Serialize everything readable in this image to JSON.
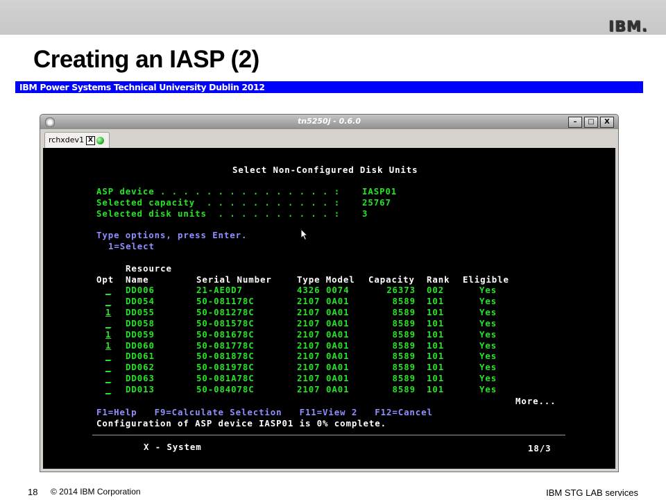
{
  "slide": {
    "logo": "IBM.",
    "title": "Creating an IASP (2)",
    "subtitle": "IBM Power Systems Technical  University Dublin 2012",
    "page_number": "18",
    "copyright": "© 2014 IBM Corporation",
    "footer_right": "IBM STG LAB services"
  },
  "window": {
    "title": "tn5250j - 0.6.0",
    "buttons": {
      "minimize": "–",
      "maximize": "□",
      "close": "X"
    },
    "tab": {
      "label": "rchxdev1",
      "close": "X"
    }
  },
  "screen": {
    "heading": "Select Non-Configured Disk Units",
    "fields": [
      {
        "label": "ASP device . . . . . . . . . . . . . . . :",
        "value": "IASP01"
      },
      {
        "label": "Selected capacity  . . . . . . . . . . . :",
        "value": "25767"
      },
      {
        "label": "Selected disk units  . . . . . . . . . . :",
        "value": "3"
      }
    ],
    "instructions": "Type options, press Enter.",
    "option_legend": "1=Select",
    "headers": {
      "resource": "Resource",
      "opt": "Opt",
      "name": "Name",
      "serial": "Serial Number",
      "type_model": "Type Model",
      "capacity": "Capacity",
      "rank": "Rank",
      "eligible": "Eligible"
    },
    "rows": [
      {
        "opt": "_",
        "name": "DD006",
        "serial": "21-AE0D7",
        "type": "4326",
        "model": "0074",
        "capacity": "26373",
        "rank": "002",
        "eligible": "Yes"
      },
      {
        "opt": "_",
        "name": "DD054",
        "serial": "50-081178C",
        "type": "2107",
        "model": "0A01",
        "capacity": "8589",
        "rank": "101",
        "eligible": "Yes"
      },
      {
        "opt": "1",
        "name": "DD055",
        "serial": "50-081278C",
        "type": "2107",
        "model": "0A01",
        "capacity": "8589",
        "rank": "101",
        "eligible": "Yes"
      },
      {
        "opt": "_",
        "name": "DD058",
        "serial": "50-081578C",
        "type": "2107",
        "model": "0A01",
        "capacity": "8589",
        "rank": "101",
        "eligible": "Yes"
      },
      {
        "opt": "1",
        "name": "DD059",
        "serial": "50-081678C",
        "type": "2107",
        "model": "0A01",
        "capacity": "8589",
        "rank": "101",
        "eligible": "Yes"
      },
      {
        "opt": "1",
        "name": "DD060",
        "serial": "50-081778C",
        "type": "2107",
        "model": "0A01",
        "capacity": "8589",
        "rank": "101",
        "eligible": "Yes"
      },
      {
        "opt": "_",
        "name": "DD061",
        "serial": "50-081878C",
        "type": "2107",
        "model": "0A01",
        "capacity": "8589",
        "rank": "101",
        "eligible": "Yes"
      },
      {
        "opt": "_",
        "name": "DD062",
        "serial": "50-081978C",
        "type": "2107",
        "model": "0A01",
        "capacity": "8589",
        "rank": "101",
        "eligible": "Yes"
      },
      {
        "opt": "_",
        "name": "DD063",
        "serial": "50-081A78C",
        "type": "2107",
        "model": "0A01",
        "capacity": "8589",
        "rank": "101",
        "eligible": "Yes"
      },
      {
        "opt": "_",
        "name": "DD013",
        "serial": "50-084078C",
        "type": "2107",
        "model": "0A01",
        "capacity": "8589",
        "rank": "101",
        "eligible": "Yes"
      }
    ],
    "more": "More...",
    "fkeys": "F1=Help   F9=Calculate Selection   F11=View 2   F12=Cancel",
    "message": "Configuration of ASP device IASP01 is 0% complete.",
    "status_system": "X - System",
    "status_position": "18/3"
  },
  "colors": {
    "green": "#25e425",
    "blue": "#8f8fff",
    "white": "#ffffff",
    "subtitle_bar": "#0000ff",
    "background": "#000000"
  }
}
